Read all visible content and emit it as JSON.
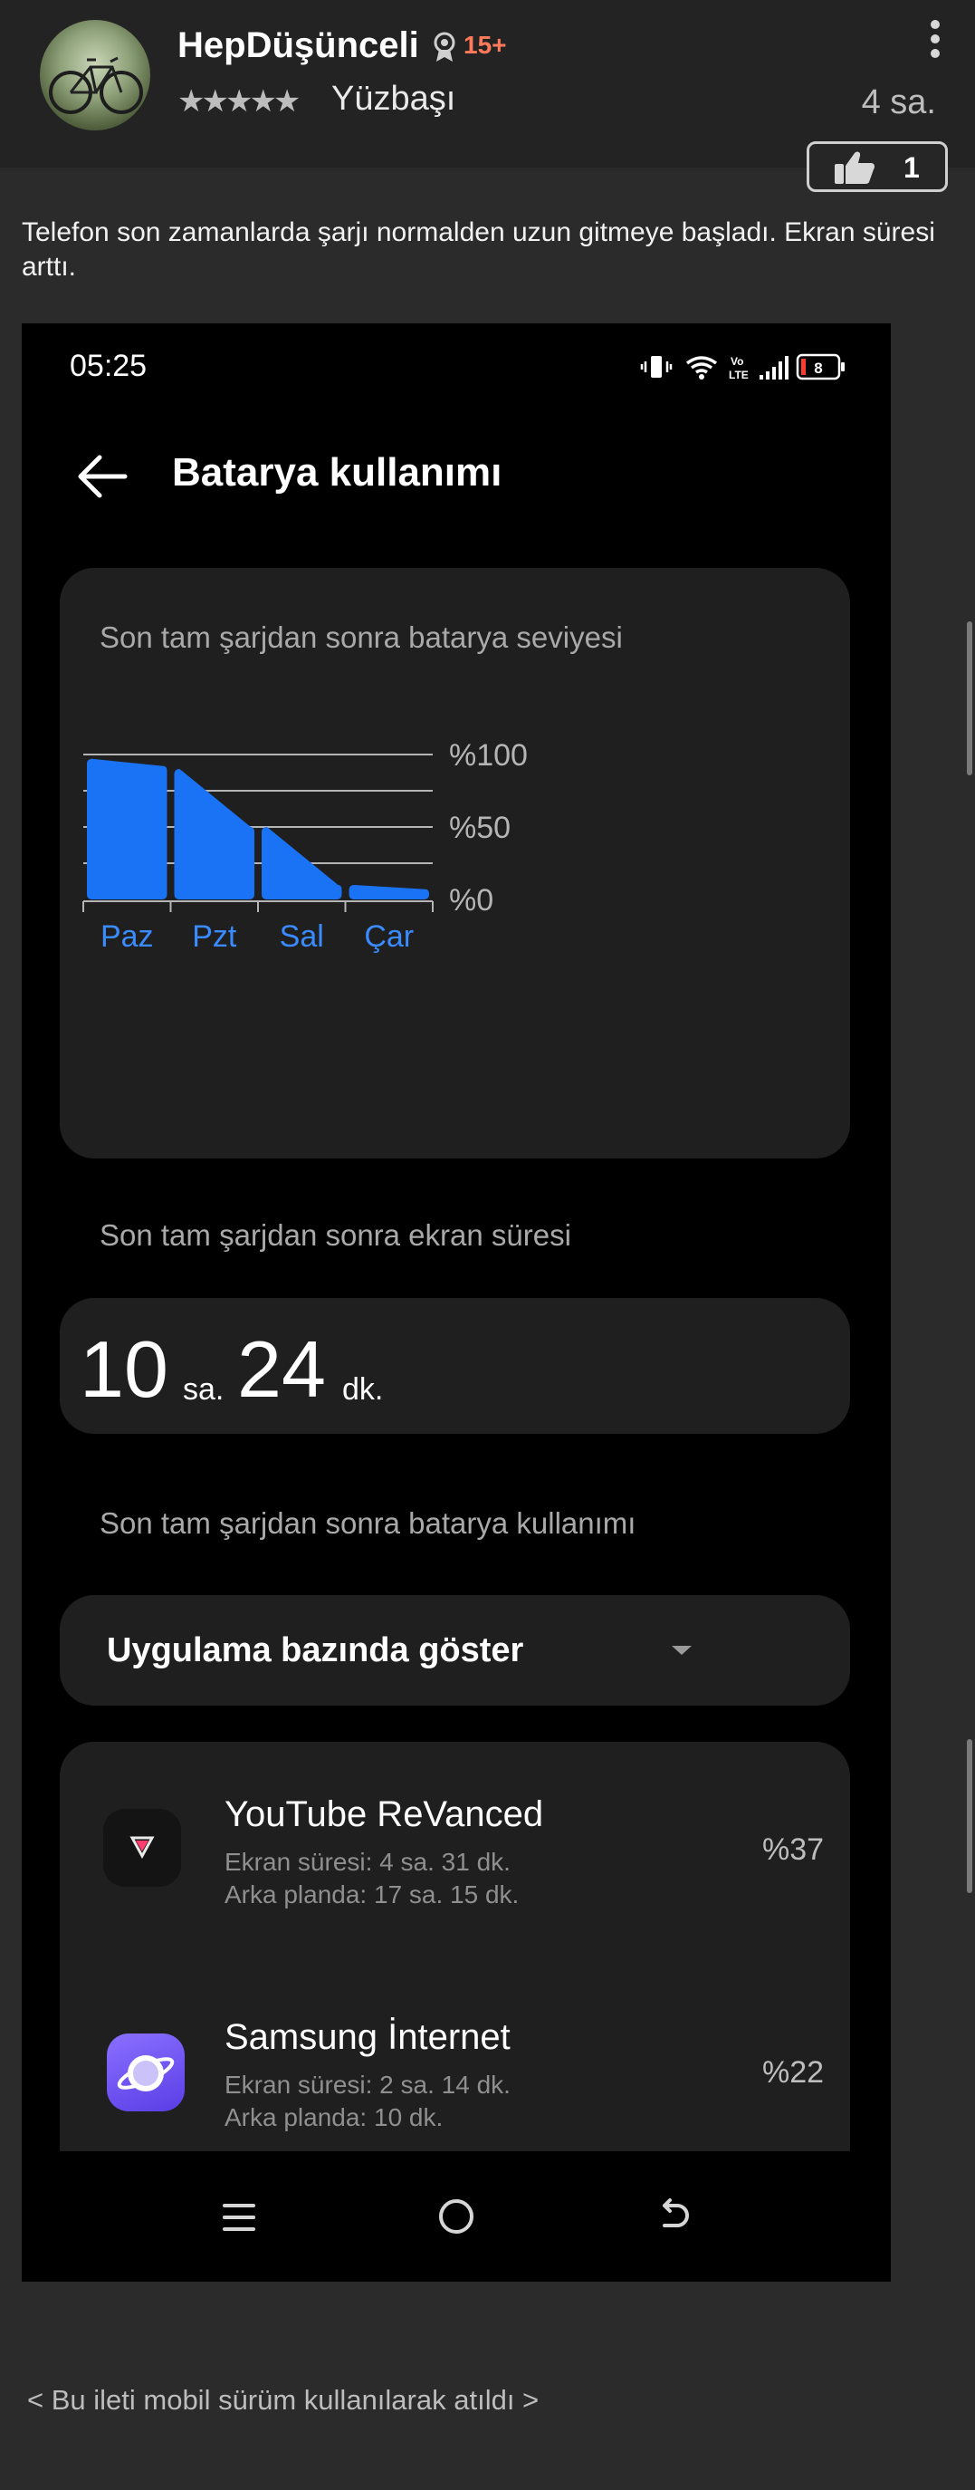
{
  "post": {
    "username": "HepDüşünceli",
    "badge_count": "15+",
    "stars": "★★★★★",
    "rank": "Yüzbaşı",
    "time_ago": "4 sa.",
    "likes": "1",
    "text": "Telefon son zamanlarda şarjı normalden uzun gitmeye başladı. Ekran süresi arttı."
  },
  "screenshot": {
    "status_time": "05:25",
    "battery_level": "8",
    "title": "Batarya kullanımı",
    "chart_title": "Son tam şarjdan sonra batarya seviyesi",
    "screen_time_label": "Son tam şarjdan sonra ekran süresi",
    "screen_time": {
      "hours": "10",
      "hours_unit": "sa.",
      "minutes": "24",
      "minutes_unit": "dk."
    },
    "usage_label": "Son tam şarjdan sonra batarya kullanımı",
    "dropdown_label": "Uygulama bazında göster",
    "apps": [
      {
        "name": "YouTube ReVanced",
        "screen": "Ekran süresi: 4 sa. 31 dk.",
        "background": "Arka planda: 17 sa. 15 dk.",
        "percent": "%37",
        "icon": "youtube-revanced-icon"
      },
      {
        "name": "Samsung İnternet",
        "screen": "Ekran süresi: 2 sa. 14 dk.",
        "background": "Arka planda: 10 dk.",
        "percent": "%22",
        "icon": "samsung-internet-icon"
      }
    ]
  },
  "footer": {
    "note": "< Bu ileti mobil sürüm kullanılarak atıldı >"
  },
  "colors": {
    "chart_fill": "#1a73f5",
    "badge": "#ff7a5a",
    "day_label": "#3a8bff"
  },
  "chart_data": {
    "type": "area",
    "title": "Son tam şarjdan sonra batarya seviyesi",
    "categories": [
      "Paz",
      "Pzt",
      "Sal",
      "Çar"
    ],
    "y_tick_labels": [
      "%100",
      "%50",
      "%0"
    ],
    "ylim": [
      0,
      100
    ],
    "grid": true,
    "series": [
      {
        "segments": [
          {
            "day": "Paz",
            "start": 97,
            "end": 92
          },
          {
            "day": "Pzt",
            "start": 90,
            "end": 50
          },
          {
            "day": "Sal",
            "start": 50,
            "end": 10
          },
          {
            "day": "Çar",
            "start": 10,
            "end": 7
          }
        ]
      }
    ]
  }
}
